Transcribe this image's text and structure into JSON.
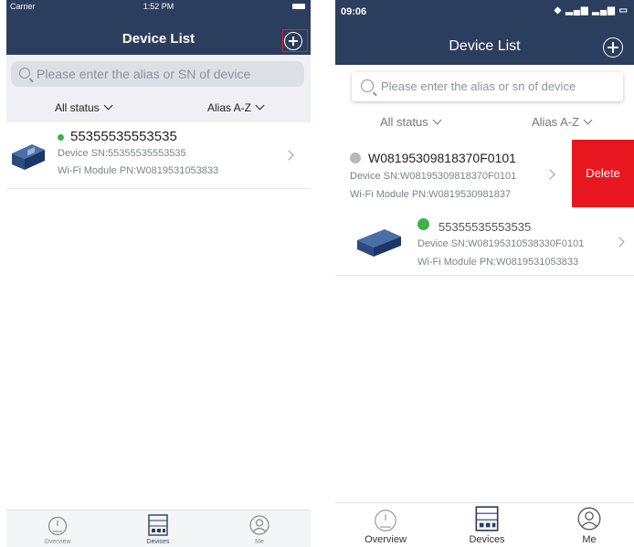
{
  "left": {
    "status_bar": {
      "carrier": "Carrier",
      "time": "1:52 PM"
    },
    "header": {
      "title": "Device List"
    },
    "search": {
      "placeholder": "Please enter the alias or SN of device"
    },
    "filters": {
      "status": "All status",
      "sort": "Alias A-Z"
    },
    "devices": [
      {
        "alias": "55355535553535",
        "sn": "Device SN:55355535553535",
        "pn": "Wi-Fi Module PN:W0819531053833",
        "status_color": "#3cb34a"
      }
    ],
    "tabs": [
      {
        "label": "Overview",
        "icon": "gauge-icon"
      },
      {
        "label": "Devices",
        "icon": "device-grid-icon",
        "active": true
      },
      {
        "label": "Me",
        "icon": "user-icon"
      }
    ]
  },
  "right": {
    "status_bar": {
      "time": "09:06"
    },
    "header": {
      "title": "Device List"
    },
    "search": {
      "placeholder": "Please enter the alias or sn of device"
    },
    "filters": {
      "status": "All status",
      "sort": "Alias A-Z"
    },
    "devices": [
      {
        "alias": "W08195309818370F0101",
        "sn": "Device SN:W08195309818370F0101",
        "pn": "Wi-Fi Module PN:W0819530981837",
        "status_color": "#b8b8b8",
        "delete_label": "Delete"
      },
      {
        "alias": "55355535553535",
        "sn": "Device SN:W08195310538330F0101",
        "pn": "Wi-Fi Module PN:W0819531053833",
        "status_color": "#3cb34a"
      }
    ],
    "tabs": [
      {
        "label": "Overview",
        "icon": "gauge-icon"
      },
      {
        "label": "Devices",
        "icon": "device-grid-icon",
        "active": true
      },
      {
        "label": "Me",
        "icon": "user-icon"
      }
    ]
  },
  "colors": {
    "header": "#2b3e5e",
    "delete": "#e8161e",
    "online": "#3cb34a",
    "offline": "#b8b8b8"
  }
}
